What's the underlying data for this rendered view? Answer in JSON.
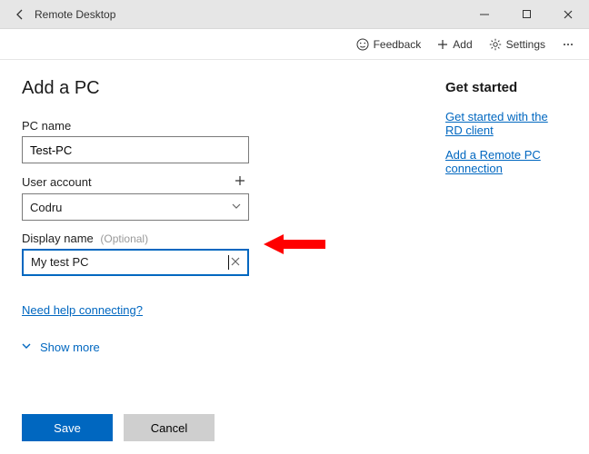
{
  "window": {
    "title": "Remote Desktop"
  },
  "toolbar": {
    "feedback": "Feedback",
    "add": "Add",
    "settings": "Settings"
  },
  "page": {
    "title": "Add a PC",
    "pc_name_label": "PC name",
    "pc_name_value": "Test-PC",
    "user_account_label": "User account",
    "user_account_value": "Codru",
    "display_name_label": "Display name",
    "display_name_optional": "(Optional)",
    "display_name_value": "My test PC",
    "help_link": "Need help connecting?",
    "show_more": "Show more"
  },
  "rail": {
    "heading": "Get started",
    "link1": "Get started with the RD client",
    "link2": "Add a Remote PC connection"
  },
  "footer": {
    "save": "Save",
    "cancel": "Cancel"
  }
}
